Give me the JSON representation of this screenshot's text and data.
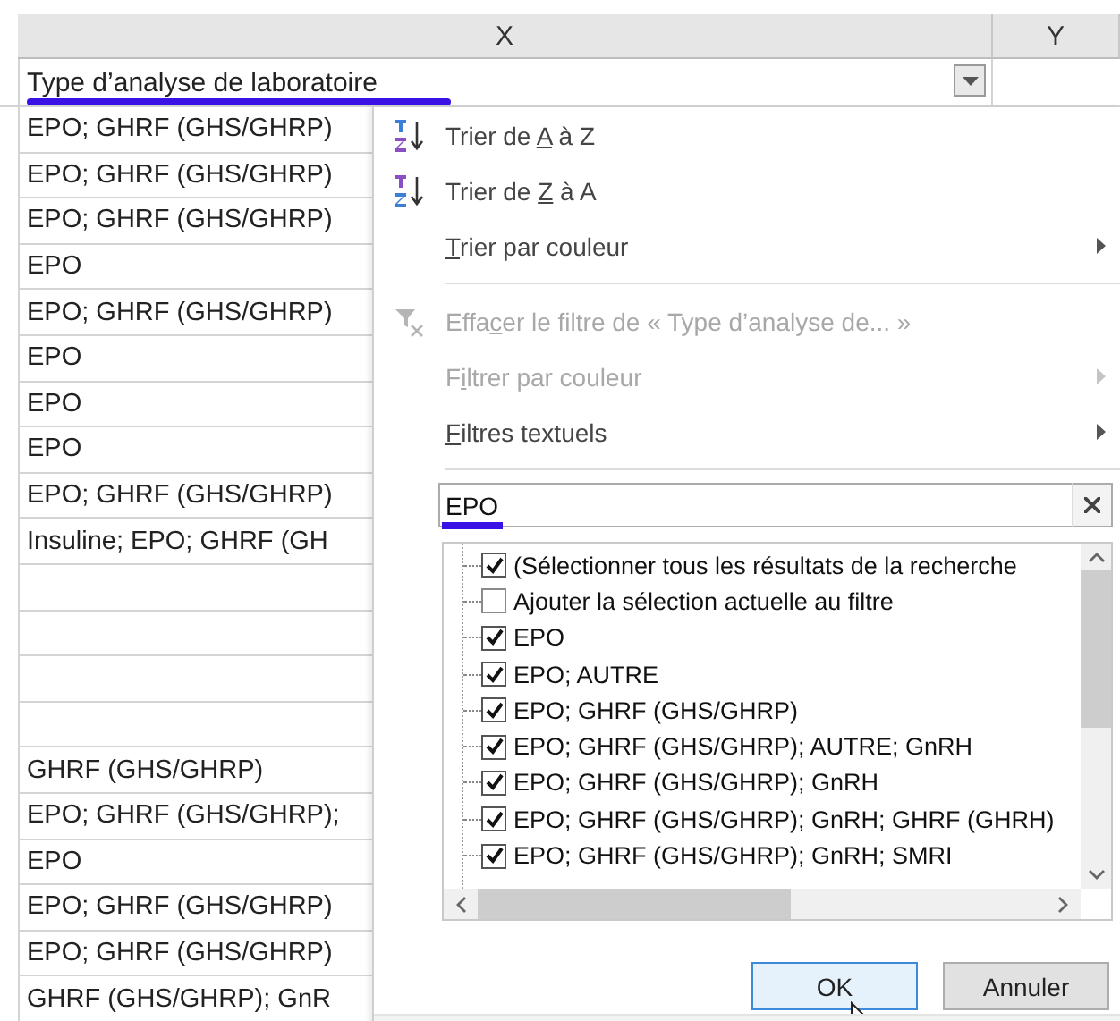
{
  "columns": [
    {
      "label": "X"
    },
    {
      "label": "Y"
    }
  ],
  "header_cell": {
    "text": "Type d’analyse de laboratoire",
    "annotated": true
  },
  "cells": [
    "EPO; GHRF (GHS/GHRP)",
    "EPO; GHRF (GHS/GHRP)",
    "EPO; GHRF (GHS/GHRP)",
    "EPO",
    "EPO; GHRF (GHS/GHRP)",
    "EPO",
    "EPO",
    "EPO",
    "EPO; GHRF (GHS/GHRP)",
    "Insuline; EPO; GHRF (GH",
    "",
    "",
    "",
    "",
    "GHRF (GHS/GHRP)",
    "EPO; GHRF (GHS/GHRP);",
    "EPO",
    "EPO; GHRF (GHS/GHRP)",
    "EPO; GHRF (GHS/GHRP)",
    "GHRF (GHS/GHRP); GnR"
  ],
  "menu": [
    {
      "kind": "sort_asc",
      "before": "Trier de ",
      "key": "A",
      "after": " à Z",
      "disabled": false,
      "submenu": false
    },
    {
      "kind": "sort_desc",
      "before": "Trier de ",
      "key": "Z",
      "after": " à A",
      "disabled": false,
      "submenu": false
    },
    {
      "kind": "plain",
      "key": "T",
      "after": "rier par couleur",
      "disabled": false,
      "submenu": true
    },
    {
      "kind": "separator"
    },
    {
      "kind": "clear_filter",
      "before": "Effa",
      "key": "c",
      "after": "er le filtre de « Type d’analyse de... »",
      "disabled": true,
      "submenu": false
    },
    {
      "kind": "plain",
      "before": "F",
      "key": "i",
      "after": "ltrer par couleur",
      "disabled": true,
      "submenu": true
    },
    {
      "kind": "plain",
      "key": "F",
      "after": "iltres textuels",
      "disabled": false,
      "submenu": true
    },
    {
      "kind": "separator"
    }
  ],
  "search": {
    "value": "EPO",
    "annotated": true
  },
  "list": [
    {
      "label": "(Sélectionner tous les résultats de la recherche",
      "checked": true
    },
    {
      "label": "Ajouter la sélection actuelle au filtre",
      "checked": false
    },
    {
      "label": "EPO",
      "checked": true
    },
    {
      "label": "EPO; AUTRE",
      "checked": true
    },
    {
      "label": "EPO; GHRF (GHS/GHRP)",
      "checked": true
    },
    {
      "label": "EPO; GHRF (GHS/GHRP); AUTRE; GnRH",
      "checked": true
    },
    {
      "label": "EPO; GHRF (GHS/GHRP); GnRH",
      "checked": true
    },
    {
      "label": "EPO; GHRF (GHS/GHRP); GnRH; GHRF (GHRH)",
      "checked": true
    },
    {
      "label": "EPO; GHRF (GHS/GHRP); GnRH; SMRI",
      "checked": true
    }
  ],
  "buttons": [
    {
      "label": "OK",
      "default": true
    },
    {
      "label": "Annuler",
      "default": false
    }
  ]
}
